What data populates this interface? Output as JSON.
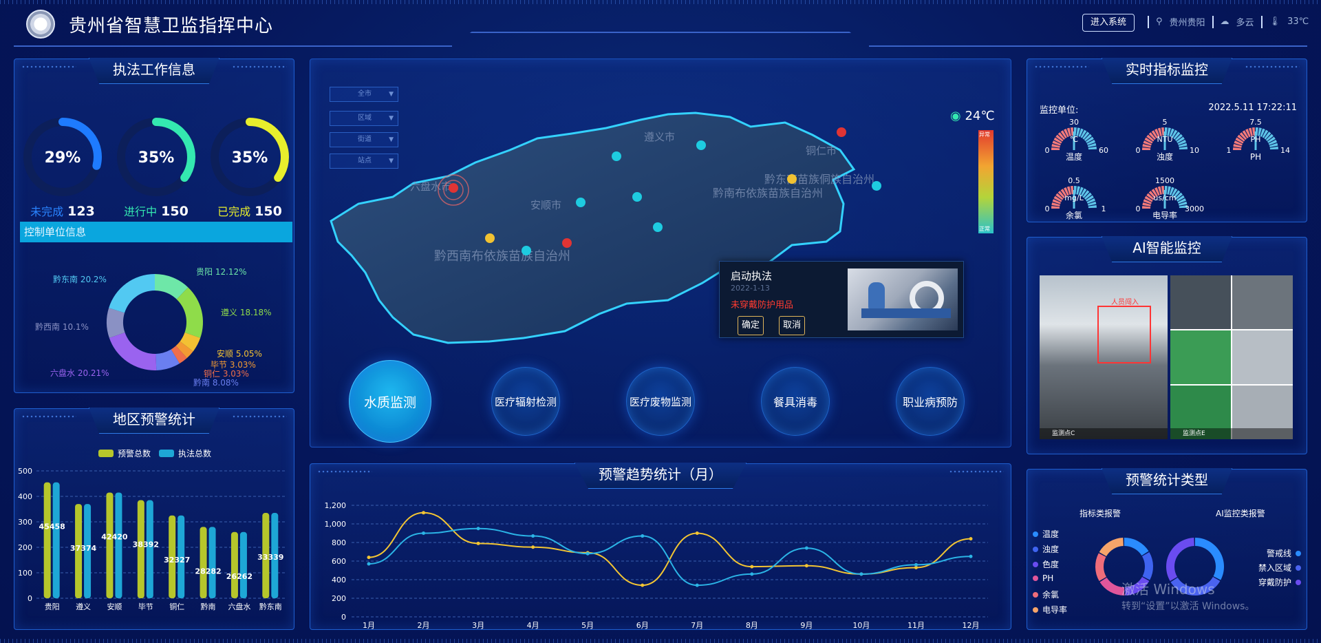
{
  "header": {
    "title": "贵州省智慧卫监指挥中心",
    "enter_button": "进入系统",
    "location": "贵州贵阳",
    "weather": "多云",
    "temperature": "33℃"
  },
  "law_panel": {
    "title": "执法工作信息",
    "rings": [
      {
        "percent": "29%",
        "label": "未完成",
        "value": "123",
        "color": "#1e7bff",
        "ratio": 0.29
      },
      {
        "percent": "35%",
        "label": "进行中",
        "value": "150",
        "color": "#34e8b0",
        "ratio": 0.35
      },
      {
        "percent": "35%",
        "label": "已完成",
        "value": "150",
        "color": "#e8ee2c",
        "ratio": 0.35
      }
    ],
    "control_title": "控制单位信息",
    "donut_labels": [
      {
        "text": "贵阳 12.12%",
        "color": "#6ee7a8"
      },
      {
        "text": "遵义 18.18%",
        "color": "#8fdc4a"
      },
      {
        "text": "安顺 5.05%",
        "color": "#f3c133"
      },
      {
        "text": "毕节 3.03%",
        "color": "#f39a33"
      },
      {
        "text": "铜仁 3.03%",
        "color": "#f06e4a"
      },
      {
        "text": "黔南 8.08%",
        "color": "#6a7ff0"
      },
      {
        "text": "六盘水 20.21%",
        "color": "#9a63ef"
      },
      {
        "text": "黔西南 10.1%",
        "color": "#8a91c4"
      },
      {
        "text": "黔东南 20.2%",
        "color": "#52c9f2"
      }
    ],
    "donut_values": [
      12.12,
      18.18,
      5.05,
      3.03,
      3.03,
      8.08,
      20.21,
      10.1,
      20.2
    ]
  },
  "region_panel": {
    "title": "地区预警统计",
    "chart_data": {
      "type": "bar",
      "categories": [
        "贵阳",
        "遵义",
        "安顺",
        "毕节",
        "铜仁",
        "黔南",
        "六盘水",
        "黔东南"
      ],
      "series": [
        {
          "name": "预警总数",
          "values": [
            455,
            370,
            415,
            385,
            325,
            280,
            260,
            335
          ],
          "color": "#b6c62b"
        },
        {
          "name": "执法总数",
          "values": [
            455,
            370,
            415,
            385,
            325,
            280,
            260,
            335
          ],
          "color": "#1ea7d6"
        }
      ],
      "value_labels": [
        "45458",
        "37374",
        "42420",
        "38392",
        "32327",
        "28282",
        "26262",
        "33339"
      ],
      "yticks": [
        "0",
        "100",
        "200",
        "300",
        "400",
        "500"
      ],
      "ylim": [
        0,
        500
      ]
    }
  },
  "map_panel": {
    "filters": [
      "全市",
      "区域",
      "街道",
      "站点"
    ],
    "temperature": "24℃",
    "scale_top": "异常",
    "scale_bottom": "正常",
    "popup": {
      "title": "启动执法",
      "date": "2022-1-13",
      "message": "未穿戴防护用品",
      "confirm": "确定",
      "cancel": "取消"
    },
    "buttons": [
      "水质监测",
      "医疗辐射检测",
      "医疗废物监测",
      "餐具消毒",
      "职业病预防"
    ],
    "region_labels": [
      "六盘水市",
      "安顺市",
      "遵义市",
      "铜仁市",
      "黔南布依族苗族自治州",
      "黔东南苗族侗族自治州",
      "黔西南布依族苗族自治州"
    ]
  },
  "trend_panel": {
    "title": "预警趋势统计（月）",
    "chart_data": {
      "type": "line",
      "categories": [
        "1月",
        "2月",
        "3月",
        "4月",
        "5月",
        "6月",
        "7月",
        "8月",
        "9月",
        "10月",
        "11月",
        "12月"
      ],
      "series": [
        {
          "values": [
            640,
            1120,
            790,
            750,
            690,
            340,
            900,
            540,
            550,
            460,
            530,
            840
          ],
          "color": "#f3c533"
        },
        {
          "values": [
            570,
            900,
            950,
            870,
            680,
            870,
            340,
            460,
            740,
            460,
            560,
            650
          ],
          "color": "#2bb4e6"
        }
      ],
      "yticks": [
        "0",
        "200",
        "400",
        "600",
        "800",
        "1,000",
        "1,200"
      ],
      "ylim": [
        0,
        1200
      ]
    }
  },
  "realtime_panel": {
    "title": "实时指标监控",
    "unit_label": "监控单位:",
    "datetime": "2022.5.11 17:22:11",
    "gauges": [
      {
        "name": "温度",
        "unit": "℃",
        "min": "0",
        "max": "60",
        "top": "30",
        "ratio": 0.5
      },
      {
        "name": "浊度",
        "unit": "NTU",
        "min": "0",
        "max": "10",
        "top": "5",
        "ratio": 0.5
      },
      {
        "name": "PH",
        "unit": "PH",
        "min": "1",
        "max": "14",
        "top": "7.5",
        "ratio": 0.5
      },
      {
        "name": "余氯",
        "unit": "mg/L",
        "min": "0",
        "max": "1",
        "top": "0.5",
        "ratio": 0.5
      },
      {
        "name": "电导率",
        "unit": "us/cm",
        "min": "0",
        "max": "3000",
        "top": "1500",
        "ratio": 0.5
      }
    ]
  },
  "ai_panel": {
    "title": "AI智能监控",
    "cam1_label": "监测点C",
    "cam2_label": "监测点E",
    "alert_label": "人员闯入"
  },
  "type_panel": {
    "title": "预警统计类型",
    "left_title": "指标类报警",
    "right_title": "AI监控类报警",
    "left_items": [
      {
        "label": "温度",
        "color": "#2a8cff"
      },
      {
        "label": "浊度",
        "color": "#3f64f0"
      },
      {
        "label": "色度",
        "color": "#6a4cf0"
      },
      {
        "label": "PH",
        "color": "#e0569b"
      },
      {
        "label": "余氯",
        "color": "#ef6d7a"
      },
      {
        "label": "电导率",
        "color": "#f6a46a"
      }
    ],
    "right_items": [
      {
        "label": "警戒线",
        "color": "#2a8cff"
      },
      {
        "label": "禁入区域",
        "color": "#4a63f0"
      },
      {
        "label": "穿戴防护",
        "color": "#6a4cf0"
      }
    ]
  },
  "watermark": {
    "line1": "激活 Windows",
    "line2": "转到“设置”以激活 Windows。"
  }
}
